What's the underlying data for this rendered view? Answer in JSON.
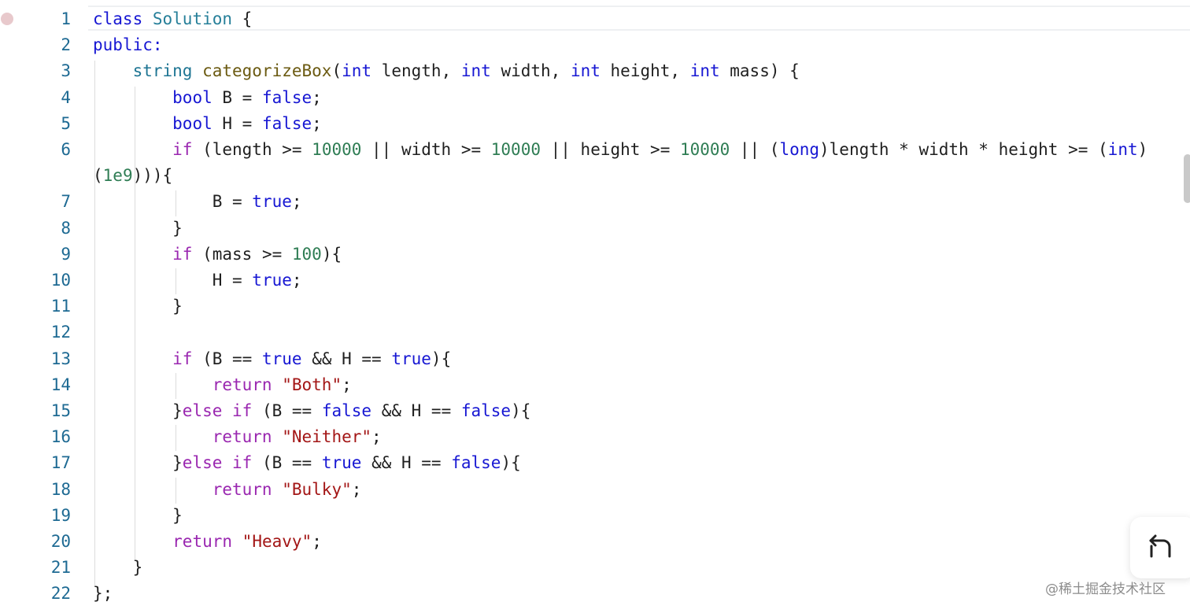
{
  "editor": {
    "lines": [
      {
        "number": "1",
        "tokens": [
          [
            "kw",
            "class"
          ],
          [
            "pl",
            " "
          ],
          [
            "cls",
            "Solution"
          ],
          [
            "pl",
            " {"
          ]
        ]
      },
      {
        "number": "2",
        "tokens": [
          [
            "kw",
            "public:"
          ]
        ]
      },
      {
        "number": "3",
        "tokens": [
          [
            "pl",
            "    "
          ],
          [
            "ty",
            "string"
          ],
          [
            "pl",
            " "
          ],
          [
            "fn",
            "categorizeBox"
          ],
          [
            "pl",
            "("
          ],
          [
            "kw",
            "int"
          ],
          [
            "pl",
            " length, "
          ],
          [
            "kw",
            "int"
          ],
          [
            "pl",
            " width, "
          ],
          [
            "kw",
            "int"
          ],
          [
            "pl",
            " height, "
          ],
          [
            "kw",
            "int"
          ],
          [
            "pl",
            " mass) {"
          ]
        ]
      },
      {
        "number": "4",
        "tokens": [
          [
            "pl",
            "        "
          ],
          [
            "kw",
            "bool"
          ],
          [
            "pl",
            " B = "
          ],
          [
            "kw",
            "false"
          ],
          [
            "pl",
            ";"
          ]
        ]
      },
      {
        "number": "5",
        "tokens": [
          [
            "pl",
            "        "
          ],
          [
            "kw",
            "bool"
          ],
          [
            "pl",
            " H = "
          ],
          [
            "kw",
            "false"
          ],
          [
            "pl",
            ";"
          ]
        ]
      },
      {
        "number": "6",
        "tokens": [
          [
            "pl",
            "        "
          ],
          [
            "ctl",
            "if"
          ],
          [
            "pl",
            " (length >= "
          ],
          [
            "num",
            "10000"
          ],
          [
            "pl",
            " || width >= "
          ],
          [
            "num",
            "10000"
          ],
          [
            "pl",
            " || height >= "
          ],
          [
            "num",
            "10000"
          ],
          [
            "pl",
            " || ("
          ],
          [
            "kw",
            "long"
          ],
          [
            "pl",
            ")length * width * height >= ("
          ],
          [
            "kw",
            "int"
          ],
          [
            "pl",
            ")"
          ]
        ]
      },
      {
        "number": "",
        "tokens": [
          [
            "pl",
            "("
          ],
          [
            "num",
            "1e9"
          ],
          [
            "pl",
            "))){"
          ]
        ]
      },
      {
        "number": "7",
        "tokens": [
          [
            "pl",
            "            B = "
          ],
          [
            "kw",
            "true"
          ],
          [
            "pl",
            ";"
          ]
        ]
      },
      {
        "number": "8",
        "tokens": [
          [
            "pl",
            "        }"
          ]
        ]
      },
      {
        "number": "9",
        "tokens": [
          [
            "pl",
            "        "
          ],
          [
            "ctl",
            "if"
          ],
          [
            "pl",
            " (mass >= "
          ],
          [
            "num",
            "100"
          ],
          [
            "pl",
            "){"
          ]
        ]
      },
      {
        "number": "10",
        "tokens": [
          [
            "pl",
            "            H = "
          ],
          [
            "kw",
            "true"
          ],
          [
            "pl",
            ";"
          ]
        ]
      },
      {
        "number": "11",
        "tokens": [
          [
            "pl",
            "        }"
          ]
        ]
      },
      {
        "number": "12",
        "tokens": []
      },
      {
        "number": "13",
        "tokens": [
          [
            "pl",
            "        "
          ],
          [
            "ctl",
            "if"
          ],
          [
            "pl",
            " (B == "
          ],
          [
            "kw",
            "true"
          ],
          [
            "pl",
            " && H == "
          ],
          [
            "kw",
            "true"
          ],
          [
            "pl",
            "){"
          ]
        ]
      },
      {
        "number": "14",
        "tokens": [
          [
            "pl",
            "            "
          ],
          [
            "ctl",
            "return"
          ],
          [
            "pl",
            " "
          ],
          [
            "str",
            "\"Both\""
          ],
          [
            "pl",
            ";"
          ]
        ]
      },
      {
        "number": "15",
        "tokens": [
          [
            "pl",
            "        }"
          ],
          [
            "ctl",
            "else"
          ],
          [
            "pl",
            " "
          ],
          [
            "ctl",
            "if"
          ],
          [
            "pl",
            " (B == "
          ],
          [
            "kw",
            "false"
          ],
          [
            "pl",
            " && H == "
          ],
          [
            "kw",
            "false"
          ],
          [
            "pl",
            "){"
          ]
        ]
      },
      {
        "number": "16",
        "tokens": [
          [
            "pl",
            "            "
          ],
          [
            "ctl",
            "return"
          ],
          [
            "pl",
            " "
          ],
          [
            "str",
            "\"Neither\""
          ],
          [
            "pl",
            ";"
          ]
        ]
      },
      {
        "number": "17",
        "tokens": [
          [
            "pl",
            "        }"
          ],
          [
            "ctl",
            "else"
          ],
          [
            "pl",
            " "
          ],
          [
            "ctl",
            "if"
          ],
          [
            "pl",
            " (B == "
          ],
          [
            "kw",
            "true"
          ],
          [
            "pl",
            " && H == "
          ],
          [
            "kw",
            "false"
          ],
          [
            "pl",
            "){"
          ]
        ]
      },
      {
        "number": "18",
        "tokens": [
          [
            "pl",
            "            "
          ],
          [
            "ctl",
            "return"
          ],
          [
            "pl",
            " "
          ],
          [
            "str",
            "\"Bulky\""
          ],
          [
            "pl",
            ";"
          ]
        ]
      },
      {
        "number": "19",
        "tokens": [
          [
            "pl",
            "        }"
          ]
        ]
      },
      {
        "number": "20",
        "tokens": [
          [
            "pl",
            "        "
          ],
          [
            "ctl",
            "return"
          ],
          [
            "pl",
            " "
          ],
          [
            "str",
            "\"Heavy\""
          ],
          [
            "pl",
            ";"
          ]
        ]
      },
      {
        "number": "21",
        "tokens": [
          [
            "pl",
            "    }"
          ]
        ]
      },
      {
        "number": "22",
        "tokens": [
          [
            "pl",
            "};"
          ]
        ]
      }
    ]
  },
  "floating_button": {
    "icon": "undo-arrow-icon"
  },
  "watermark": {
    "text": "@稀土掘金技术社区"
  },
  "colors": {
    "keyword": "#1717d3",
    "control": "#9a27b0",
    "type": "#1e7593",
    "class": "#267f99",
    "function": "#6b5a11",
    "number": "#2f7d54",
    "string": "#a31616",
    "line_number": "#1e6a93"
  }
}
